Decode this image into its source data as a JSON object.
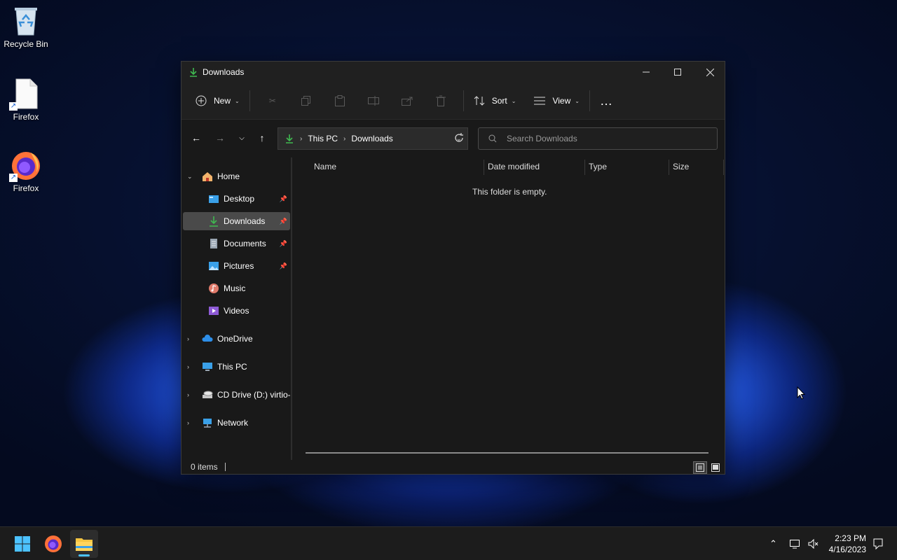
{
  "desktop": {
    "icons": [
      {
        "label": "Recycle Bin",
        "icon": "recycle-bin-icon"
      },
      {
        "label": "Firefox",
        "icon": "file-shortcut-icon"
      },
      {
        "label": "Firefox",
        "icon": "firefox-icon"
      }
    ]
  },
  "window": {
    "title": "Downloads",
    "controls": {
      "minimize": "minimize-icon",
      "maximize": "maximize-icon",
      "close": "close-icon"
    }
  },
  "commandbar": {
    "new_label": "New",
    "sort_label": "Sort",
    "view_label": "View",
    "disabled_icons": [
      "cut-icon",
      "copy-icon",
      "paste-icon",
      "rename-icon",
      "share-icon",
      "delete-icon"
    ],
    "more": "…"
  },
  "address": {
    "crumbs": [
      "This PC",
      "Downloads"
    ],
    "search_placeholder": "Search Downloads"
  },
  "sidebar": {
    "home": "Home",
    "quick": [
      {
        "label": "Desktop",
        "pinned": true
      },
      {
        "label": "Downloads",
        "pinned": true,
        "selected": true
      },
      {
        "label": "Documents",
        "pinned": true
      },
      {
        "label": "Pictures",
        "pinned": true
      },
      {
        "label": "Music",
        "pinned": false
      },
      {
        "label": "Videos",
        "pinned": false
      }
    ],
    "roots": [
      "OneDrive",
      "This PC",
      "CD Drive (D:) virtio-win",
      "Network"
    ]
  },
  "columns": [
    "Name",
    "Date modified",
    "Type",
    "Size"
  ],
  "content": {
    "empty_message": "This folder is empty."
  },
  "status": {
    "items": "0 items"
  },
  "taskbar": {
    "apps": [
      "start-icon",
      "firefox-icon",
      "file-explorer-icon"
    ],
    "time": "2:23 PM",
    "date": "4/16/2023"
  }
}
